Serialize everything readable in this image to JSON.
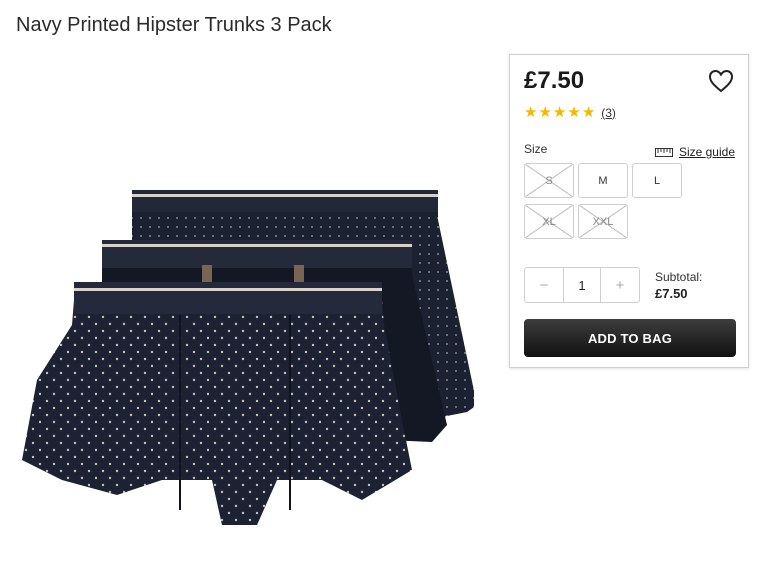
{
  "product": {
    "title": "Navy Printed Hipster Trunks 3 Pack",
    "price": "£7.50",
    "rating_count": "(3)",
    "stars": 5,
    "image_icon": "product-image"
  },
  "sizes": {
    "label": "Size",
    "guide_label": "Size guide",
    "options": [
      {
        "label": "S",
        "available": false
      },
      {
        "label": "M",
        "available": true
      },
      {
        "label": "L",
        "available": true
      },
      {
        "label": "XL",
        "available": false
      },
      {
        "label": "XXL",
        "available": false
      }
    ]
  },
  "quantity": {
    "minus": "−",
    "value": "1",
    "plus": "+"
  },
  "subtotal": {
    "label": "Subtotal:",
    "value": "£7.50"
  },
  "cart": {
    "add_label": "ADD TO BAG"
  },
  "colors": {
    "star": "#f5b700",
    "button": "#1f1f1f",
    "navy": "#1c2233"
  }
}
